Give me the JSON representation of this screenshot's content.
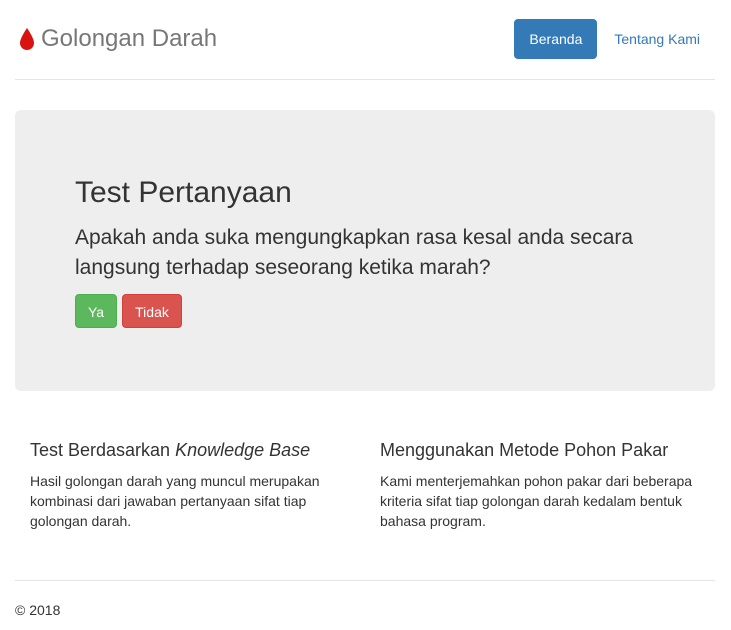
{
  "header": {
    "brand": "Golongan Darah",
    "brand_icon": "blood-drop-icon",
    "nav": [
      {
        "label": "Beranda",
        "active": true
      },
      {
        "label": "Tentang Kami",
        "active": false
      }
    ]
  },
  "jumbotron": {
    "title": "Test Pertanyaan",
    "question": "Apakah anda suka mengungkapkan rasa kesal anda secara langsung terhadap seseorang ketika marah?",
    "yes_label": "Ya",
    "no_label": "Tidak"
  },
  "features": [
    {
      "title_plain": "Test Berdasarkan ",
      "title_italic": "Knowledge Base",
      "text": "Hasil golongan darah yang muncul merupakan kombinasi dari jawaban pertanyaan sifat tiap golongan darah."
    },
    {
      "title_plain": "Menggunakan Metode Pohon Pakar",
      "title_italic": "",
      "text": "Kami menterjemahkan pohon pakar dari beberapa kriteria sifat tiap golongan darah kedalam bentuk bahasa program."
    }
  ],
  "footer": {
    "copyright": "© 2018"
  },
  "colors": {
    "primary": "#337ab7",
    "success": "#5cb85c",
    "danger": "#d9534f",
    "drop": "#d9130f"
  }
}
